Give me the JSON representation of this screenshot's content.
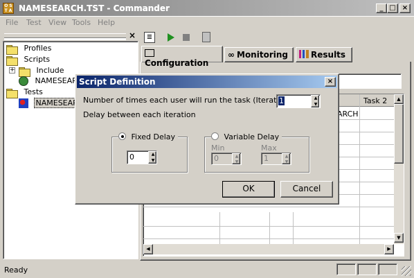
{
  "window": {
    "title": "NAMESEARCH.TST - Commander",
    "app_icon": "osta-logo-icon",
    "buttons": [
      "minimize-icon",
      "maximize-icon",
      "close-icon"
    ]
  },
  "menu": {
    "items": [
      "File",
      "Test",
      "View",
      "Tools",
      "Help"
    ]
  },
  "tree": {
    "close_glyph": "×",
    "items": [
      {
        "label": "Profiles"
      },
      {
        "label": "Scripts"
      },
      {
        "label": "Include"
      },
      {
        "label": "NAMESEARC"
      },
      {
        "label": "Tests"
      },
      {
        "label": "NAMESEARCH"
      }
    ]
  },
  "toolbar": {
    "icons": [
      "script-wizard-icon",
      "play-icon",
      "stop-icon",
      "delete-icon"
    ]
  },
  "tabs": [
    {
      "label": "Configuration",
      "icon": "book-icon",
      "active": true
    },
    {
      "label": "Monitoring",
      "icon": "glasses-icon",
      "active": false
    },
    {
      "label": "Results",
      "icon": "bar-chart-icon",
      "active": false
    }
  ],
  "grid": {
    "header_task2": "Task 2",
    "cell_fragment": "ARCH"
  },
  "dialog": {
    "title": "Script Definition",
    "iterations_label": "Number of times each user will run the task (Iterations)",
    "iterations_value": "1",
    "delay_label": "Delay between each iteration",
    "fixed_delay_label": "Fixed Delay",
    "fixed_delay_value": "0",
    "fixed_selected": true,
    "variable_delay_label": "Variable Delay",
    "min_label": "Min",
    "min_value": "0",
    "max_label": "Max",
    "max_value": "1",
    "ok_label": "OK",
    "cancel_label": "Cancel"
  },
  "status": {
    "text": "Ready"
  }
}
